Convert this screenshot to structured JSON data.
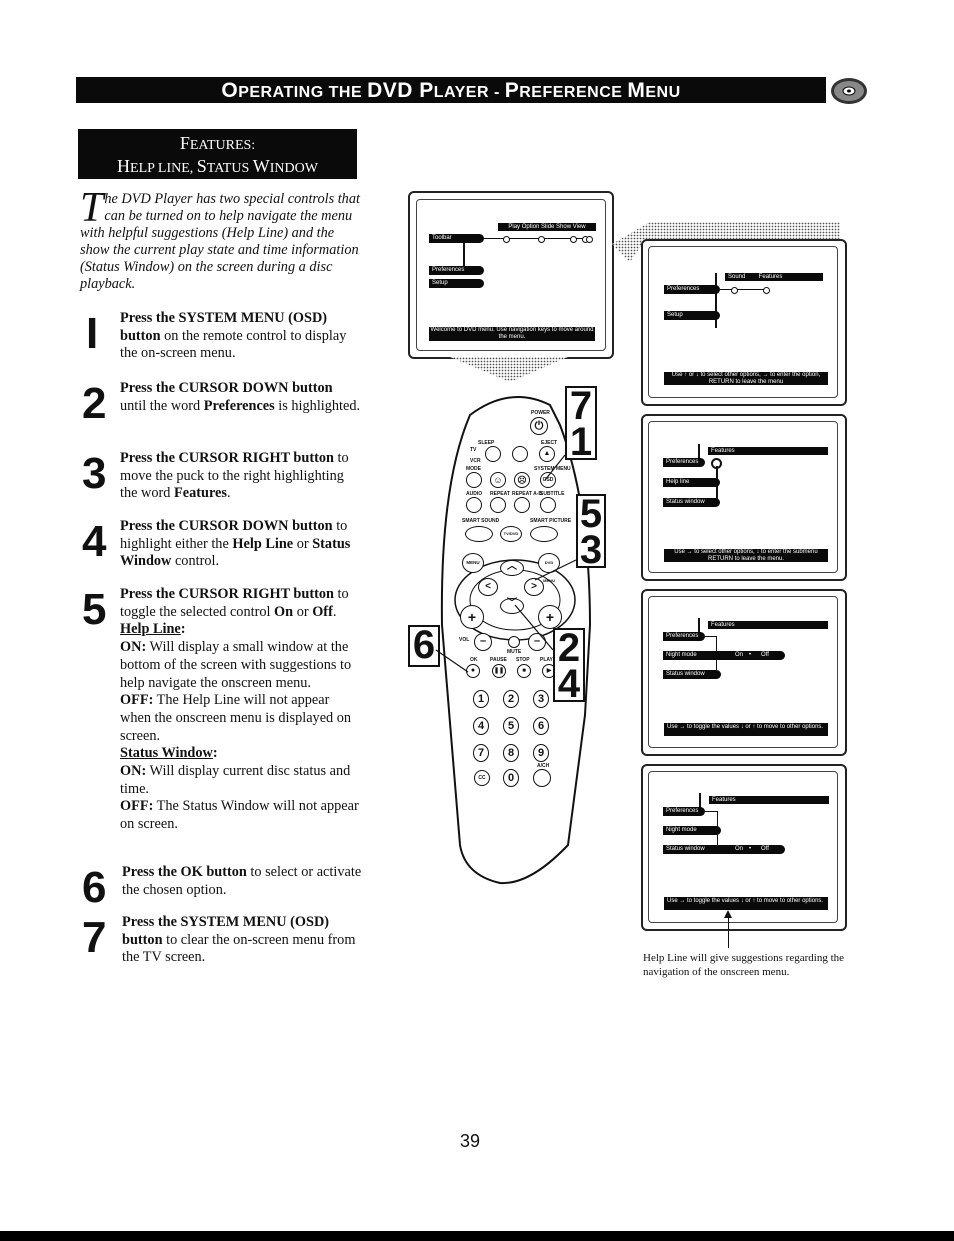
{
  "header": {
    "title_parts": [
      {
        "big": "O",
        "small": "PERATING THE "
      },
      {
        "big": "DVD P",
        "small": "LAYER - "
      },
      {
        "big": "P",
        "small": "REFERENCE "
      },
      {
        "big": "M",
        "small": "ENU"
      }
    ],
    "icon": "disc-icon"
  },
  "features_box": {
    "line1_big": "F",
    "line1_small": "EATURES:",
    "line2": [
      {
        "big": "H",
        "small": "ELP LINE, "
      },
      {
        "big": "S",
        "small": "TATUS "
      },
      {
        "big": "W",
        "small": "INDOW"
      }
    ]
  },
  "intro": {
    "dropcap": "T",
    "text": "he DVD Player has two special controls that can be turned on to help navigate the menu with helpful suggestions (Help Line) and the show the current play state and time information (Status Window) on the screen during a disc playback."
  },
  "steps": [
    {
      "number": "1",
      "bold": "Press the SYSTEM MENU (OSD) button",
      "rest": " on the remote control to display the on-screen menu."
    },
    {
      "number": "2",
      "bold": "Press the CURSOR DOWN button",
      "rest_parts": [
        " until the word ",
        {
          "b": "Preferences"
        },
        " is highlighted."
      ]
    },
    {
      "number": "3",
      "bold": "Press the CURSOR RIGHT button",
      "rest_parts": [
        " to move the puck to the right highlighting the word ",
        {
          "b": "Features"
        },
        "."
      ]
    },
    {
      "number": "4",
      "bold": "Press the CURSOR DOWN button",
      "rest_parts": [
        " to highlight either the ",
        {
          "b": "Help Line"
        },
        " or ",
        {
          "b": "Status Window"
        },
        " control."
      ]
    },
    {
      "number": "5",
      "bold": "Press the CURSOR RIGHT button",
      "rest_parts": [
        " to toggle the selected control ",
        {
          "b": "On"
        },
        " or ",
        {
          "b": "Off"
        },
        "."
      ],
      "sub": [
        {
          "heading": "Help Line:"
        },
        {
          "label": "ON:",
          "text": " Will display a small window at the bottom of the screen with suggestions to help navigate the onscreen menu."
        },
        {
          "label": "OFF:",
          "text": " The Help Line will not appear when the onscreen menu is displayed on screen."
        },
        {
          "heading": "Status Window:"
        },
        {
          "label": "ON:",
          "text": " Will display current disc status and time."
        },
        {
          "label": "OFF:",
          "text": " The Status Window will not appear on screen."
        }
      ]
    },
    {
      "number": "6",
      "bold": "Press the OK button",
      "rest": " to select or activate the chosen option."
    },
    {
      "number": "7",
      "bold": "Press the SYSTEM MENU (OSD) button",
      "rest": " to clear the on-screen menu from the TV screen."
    }
  ],
  "screens": {
    "s1": {
      "top_bar": "Play Option  Slide Show  View",
      "items": [
        "Toolbar",
        "Preferences",
        "Setup"
      ],
      "help": "Welcome to DVD menu.  Use navigation keys to move around the menu."
    },
    "s2": {
      "top_bar": "Sound        Features",
      "items": [
        "Preferences",
        "Setup"
      ],
      "help_line1": "Use ↑ or ↓ to select other options, → to enter the option,",
      "help_line2": "RETURN to leave the menu"
    },
    "s3": {
      "top_bar": "Features",
      "items": [
        "Preferences",
        "Help line",
        "Status window"
      ],
      "help_line1": "Use → to select other options, ↓ to enter the submenu",
      "help_line2": "RETURN to leave the menu."
    },
    "s4": {
      "top_bar": "Features",
      "items": [
        "Preferences",
        "Night mode",
        "Status window"
      ],
      "toggle": {
        "on": "On",
        "off": "Off"
      },
      "help": "Use → to toggle the values ↓ or ↑ to move to other options."
    },
    "s5": {
      "top_bar": "Features",
      "items": [
        "Preferences",
        "Night mode",
        "Status window"
      ],
      "toggle": {
        "on": "On",
        "off": "Off"
      },
      "help": "Use → to toggle the values ↓ or ↑ to move to other options."
    }
  },
  "remote": {
    "labels": {
      "power": "POWER",
      "sleep": "SLEEP",
      "eject": "EJECT",
      "tv": "TV",
      "vcr": "VCR",
      "mode": "MODE",
      "system_menu": "SYSTEM MENU",
      "osd": "OSD",
      "audio": "AUDIO",
      "repeat": "REPEAT",
      "repeat_ab": "REPEAT A-B",
      "subtitle": "SUBTITLE",
      "smart_sound": "SMART SOUND",
      "smart_picture": "SMART PICTURE",
      "tvdvd": "TV/DVD",
      "menu": "MENU",
      "dvd_menu": "DVD MENU",
      "vol": "VOL",
      "mute": "MUTE",
      "ok": "OK",
      "pause": "PAUSE",
      "stop": "STOP",
      "play": "PLAY",
      "ach": "A/CH",
      "cc": "CC"
    },
    "digits": [
      "1",
      "2",
      "3",
      "4",
      "5",
      "6",
      "7",
      "8",
      "9"
    ],
    "zero": "0",
    "callouts": [
      {
        "id": "c71",
        "lines": [
          "7",
          "1"
        ]
      },
      {
        "id": "c53",
        "lines": [
          "5",
          "3"
        ]
      },
      {
        "id": "c6",
        "lines": [
          "6"
        ]
      },
      {
        "id": "c24",
        "lines": [
          "2",
          "4"
        ]
      }
    ]
  },
  "caption": "Help Line will give suggestions regarding the navigation of the onscreen menu.",
  "page_number": "39"
}
